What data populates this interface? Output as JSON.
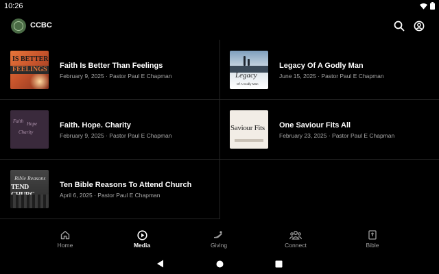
{
  "status_bar": {
    "time": "10:26"
  },
  "app_bar": {
    "title": "CCBC"
  },
  "media_items": [
    {
      "title": "Faith Is Better Than Feelings",
      "date": "February 9, 2025",
      "speaker": "Pastor Paul E Chapman",
      "thumb_text": [
        "IS BETTER",
        "FEELINGS"
      ]
    },
    {
      "title": "Legacy Of A Godly Man",
      "date": "June 15, 2025",
      "speaker": "Pastor Paul E Chapman",
      "thumb_text": [
        "Legacy",
        "Of A Godly Man"
      ]
    },
    {
      "title": "Faith. Hope. Charity",
      "date": "February 9, 2025",
      "speaker": "Pastor Paul E Chapman",
      "thumb_text": [
        "Faith",
        "Hope",
        "Charity"
      ]
    },
    {
      "title": "One Saviour Fits All",
      "date": "February 23, 2025",
      "speaker": "Pastor Paul E Chapman",
      "thumb_text": [
        "Saviour Fits"
      ]
    },
    {
      "title": "Ten Bible Reasons To Attend Church",
      "date": "April 6, 2025",
      "speaker": "Pastor Paul E Chapman",
      "thumb_text": [
        "Bible Reasons",
        "TEND CHURC"
      ]
    }
  ],
  "bottom_nav": [
    {
      "label": "Home",
      "icon": "home-icon",
      "active": false
    },
    {
      "label": "Media",
      "icon": "play-circle-icon",
      "active": true
    },
    {
      "label": "Giving",
      "icon": "giving-hand-icon",
      "active": false
    },
    {
      "label": "Connect",
      "icon": "people-icon",
      "active": false
    },
    {
      "label": "Bible",
      "icon": "bible-icon",
      "active": false
    }
  ],
  "separator": " · ",
  "colors": {
    "background": "#000000",
    "divider": "#262626",
    "subtitle": "#a8a8a8",
    "nav_inactive": "#a0a0a0",
    "logo": "#4a6b45"
  }
}
